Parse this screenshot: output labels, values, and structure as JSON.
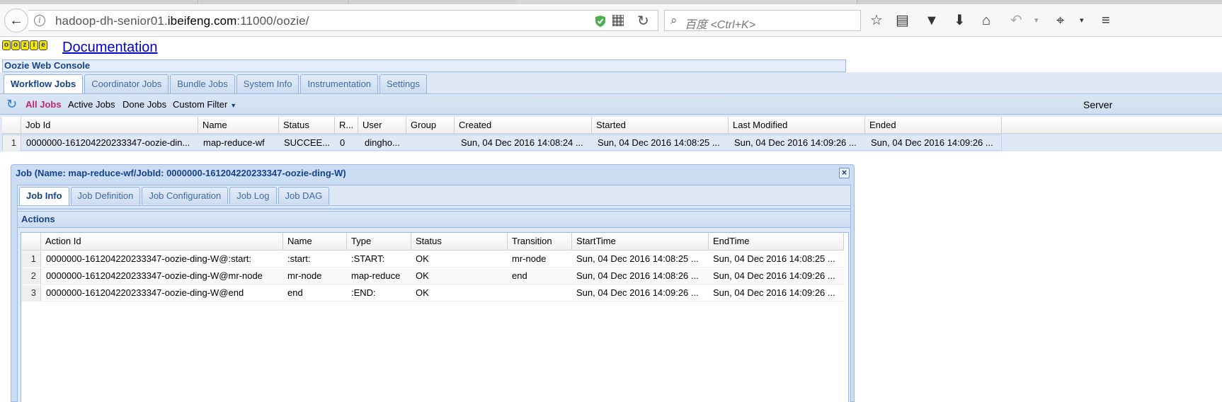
{
  "browser": {
    "url_prefix": "hadoop-dh-senior01.",
    "url_domain": "ibeifeng.com",
    "url_suffix": ":11000/oozie/",
    "search_placeholder": "百度 <Ctrl+K>"
  },
  "header": {
    "logo_letters": [
      "o",
      "o",
      "z",
      "i",
      "e"
    ],
    "documentation_link": "Documentation",
    "console_title": "Oozie Web Console"
  },
  "main_tabs": [
    "Workflow Jobs",
    "Coordinator Jobs",
    "Bundle Jobs",
    "System Info",
    "Instrumentation",
    "Settings"
  ],
  "toolbar": {
    "all_jobs": "All Jobs",
    "active_jobs": "Active Jobs",
    "done_jobs": "Done Jobs",
    "custom_filter": "Custom Filter",
    "server_label": "Server"
  },
  "jobs_table": {
    "columns": [
      "Job Id",
      "Name",
      "Status",
      "R...",
      "User",
      "Group",
      "Created",
      "Started",
      "Last Modified",
      "Ended"
    ],
    "rows": [
      {
        "num": "1",
        "job_id": "0000000-161204220233347-oozie-din...",
        "name": "map-reduce-wf",
        "status": "SUCCEE...",
        "run": "0",
        "user": "dingho...",
        "group": "",
        "created": "Sun, 04 Dec 2016 14:08:24 ...",
        "started": "Sun, 04 Dec 2016 14:08:25 ...",
        "last_modified": "Sun, 04 Dec 2016 14:09:26 ...",
        "ended": "Sun, 04 Dec 2016 14:09:26 ..."
      }
    ]
  },
  "job_window": {
    "title": "Job (Name: map-reduce-wf/JobId: 0000000-161204220233347-oozie-ding-W)",
    "close": "×",
    "tabs": [
      "Job Info",
      "Job Definition",
      "Job Configuration",
      "Job Log",
      "Job DAG"
    ],
    "actions_title": "Actions",
    "actions_columns": [
      "Action Id",
      "Name",
      "Type",
      "Status",
      "Transition",
      "StartTime",
      "EndTime"
    ],
    "actions_rows": [
      {
        "num": "1",
        "action_id": "0000000-161204220233347-oozie-ding-W@:start:",
        "name": ":start:",
        "type": ":START:",
        "status": "OK",
        "transition": "mr-node",
        "start": "Sun, 04 Dec 2016 14:08:25 ...",
        "end": "Sun, 04 Dec 2016 14:08:25 ..."
      },
      {
        "num": "2",
        "action_id": "0000000-161204220233347-oozie-ding-W@mr-node",
        "name": "mr-node",
        "type": "map-reduce",
        "status": "OK",
        "transition": "end",
        "start": "Sun, 04 Dec 2016 14:08:26 ...",
        "end": "Sun, 04 Dec 2016 14:09:26 ..."
      },
      {
        "num": "3",
        "action_id": "0000000-161204220233347-oozie-ding-W@end",
        "name": "end",
        "type": ":END:",
        "status": "OK",
        "transition": "",
        "start": "Sun, 04 Dec 2016 14:09:26 ...",
        "end": "Sun, 04 Dec 2016 14:09:26 ..."
      }
    ]
  }
}
